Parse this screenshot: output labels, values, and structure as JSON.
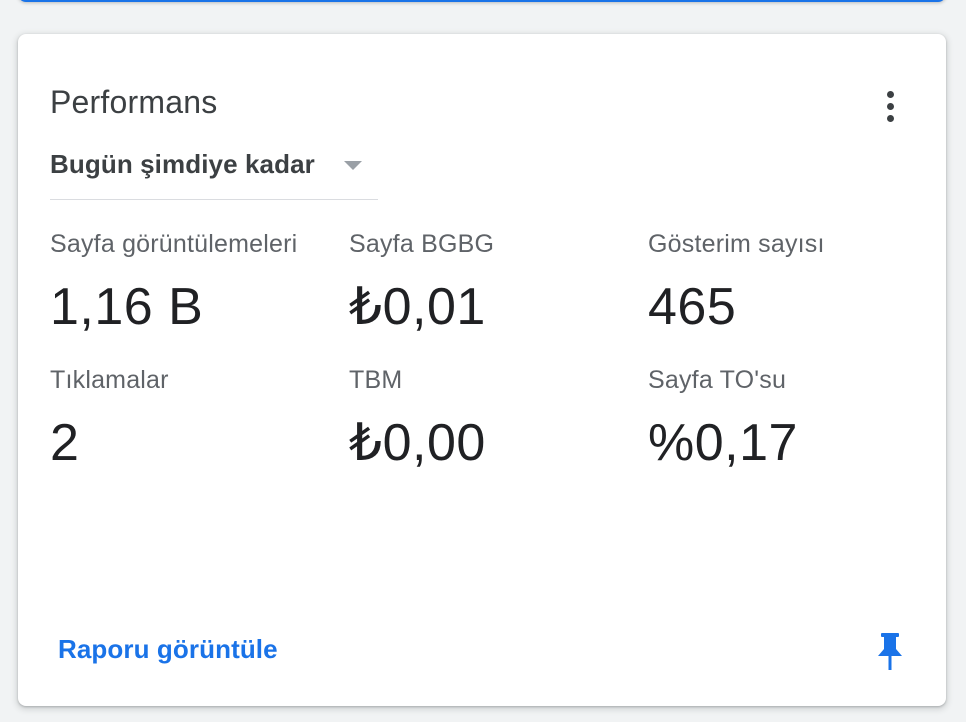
{
  "card": {
    "title": "Performans",
    "date_range": "Bugün şimdiye kadar",
    "more_icon": "more-vert-icon",
    "metrics": [
      {
        "label": "Sayfa görüntülemeleri",
        "value": "1,16 B"
      },
      {
        "label": "Sayfa BGBG",
        "value": "₺0,01"
      },
      {
        "label": "Gösterim sayısı",
        "value": "465"
      },
      {
        "label": "Tıklamalar",
        "value": "2"
      },
      {
        "label": "TBM",
        "value": "₺0,00"
      },
      {
        "label": "Sayfa TO'su",
        "value": "%0,17"
      }
    ],
    "view_report_label": "Raporu görüntüle",
    "pin_icon": "pin-icon",
    "colors": {
      "accent": "#1a73e8",
      "title": "#3c4043",
      "label": "#5f6368",
      "value": "#202124"
    }
  }
}
